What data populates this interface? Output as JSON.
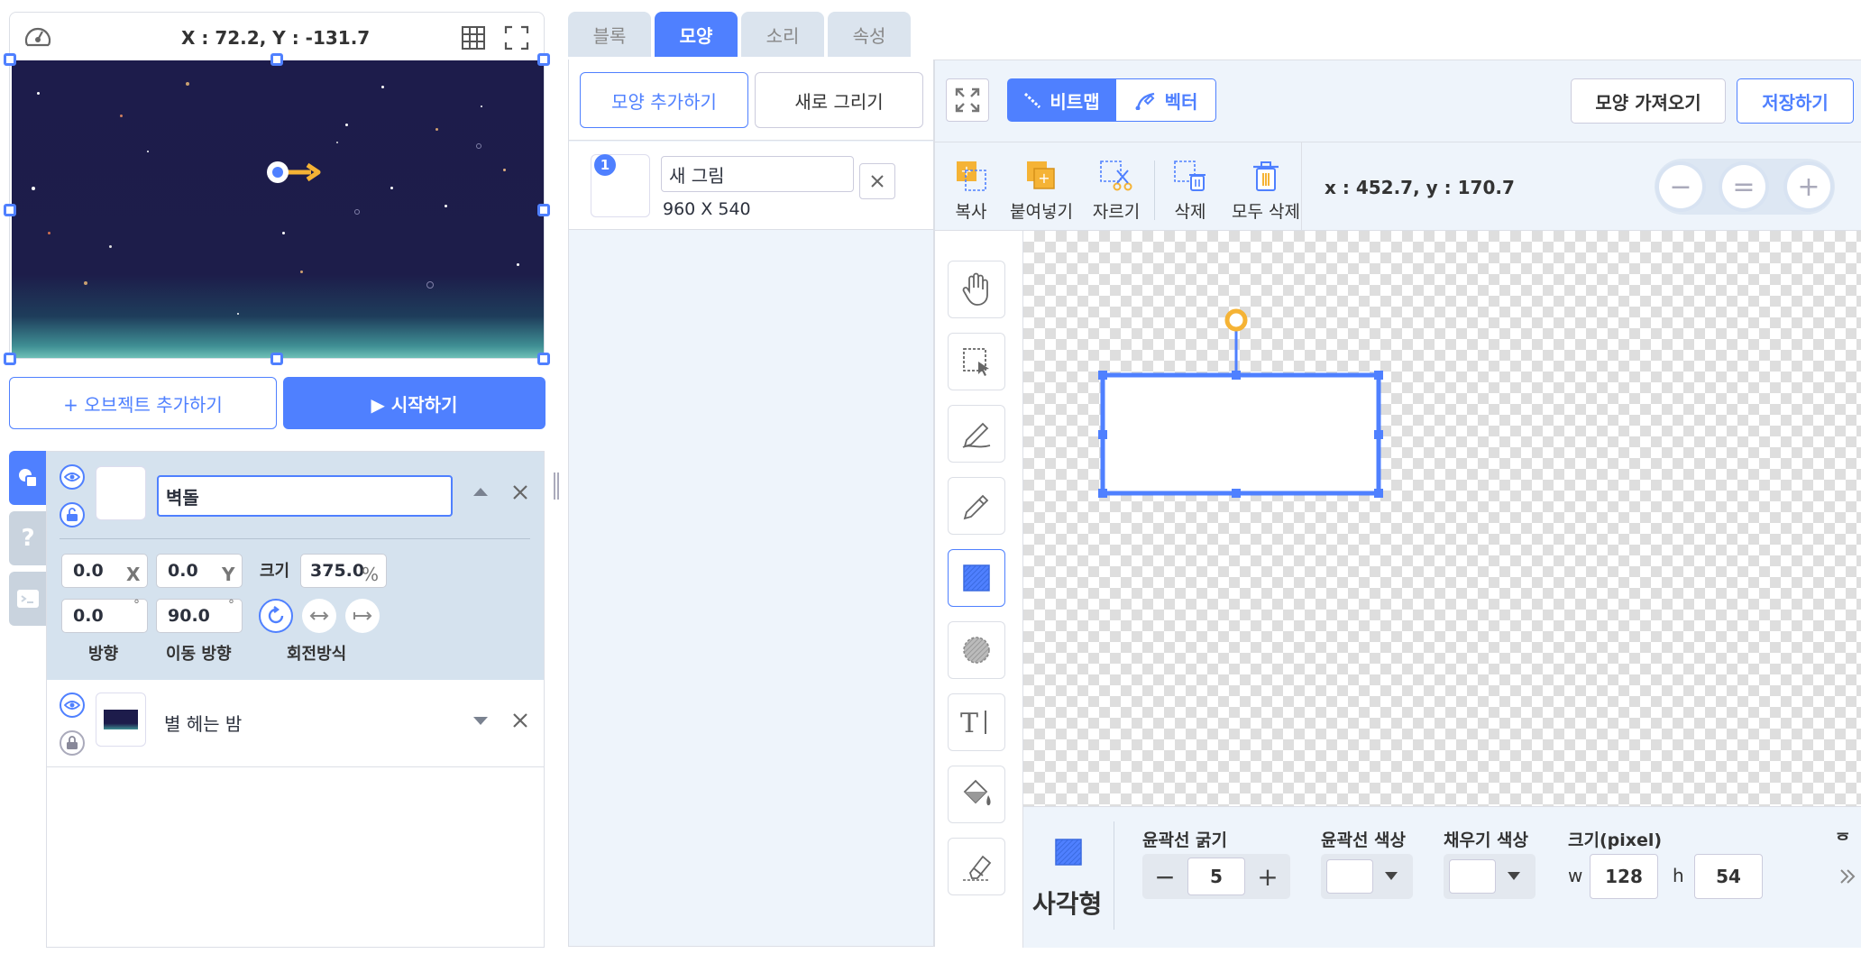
{
  "stage": {
    "coordinates": "X : 72.2, Y : -131.7",
    "add_object_label": "+ 오브젝트 추가하기",
    "start_label": "▶ 시작하기"
  },
  "objects": [
    {
      "name": "벽돌",
      "x": "0.0",
      "x_unit": "X",
      "y": "0.0",
      "y_unit": "Y",
      "size_label": "크기",
      "size": "375.0",
      "size_unit": "%",
      "direction": "0.0",
      "direction_unit": "°",
      "move_direction": "90.0",
      "move_direction_unit": "°",
      "direction_label": "방향",
      "move_direction_label": "이동 방향",
      "rotation_label": "회전방식"
    },
    {
      "name": "별 헤는 밤"
    }
  ],
  "tabs": [
    "블록",
    "모양",
    "소리",
    "속성"
  ],
  "active_tab": "모양",
  "shape_list": {
    "add_shape_label": "모양 추가하기",
    "new_drawing_label": "새로 그리기",
    "items": [
      {
        "number": "1",
        "name": "새 그림",
        "dimensions": "960 X 540"
      }
    ]
  },
  "editor": {
    "mode_bitmap": "비트맵",
    "mode_vector": "벡터",
    "import_shape_label": "모양 가져오기",
    "save_label": "저장하기",
    "toolbar": {
      "copy": "복사",
      "paste": "붙여넣기",
      "cut": "자르기",
      "delete": "삭제",
      "delete_all": "모두 삭제"
    },
    "cursor_coords": "x : 452.7, y : 170.7",
    "zoom": {
      "minus": "−",
      "reset": "=",
      "plus": "+"
    }
  },
  "properties": {
    "shape_name": "사각형",
    "stroke_width_label": "윤곽선 굵기",
    "stroke_width": "5",
    "stroke_color_label": "윤곽선 색상",
    "fill_color_label": "채우기 색상",
    "size_label": "크기(pixel)",
    "w_label": "w",
    "w": "128",
    "h_label": "h",
    "h": "54",
    "cut_label": "ᅙ"
  },
  "colors": {
    "accent": "#4f80ff",
    "stage_bg": "#1d1c4b",
    "arrow": "#f5b335",
    "panel": "#d5e2ee",
    "editor_bg": "#eef4fb"
  }
}
